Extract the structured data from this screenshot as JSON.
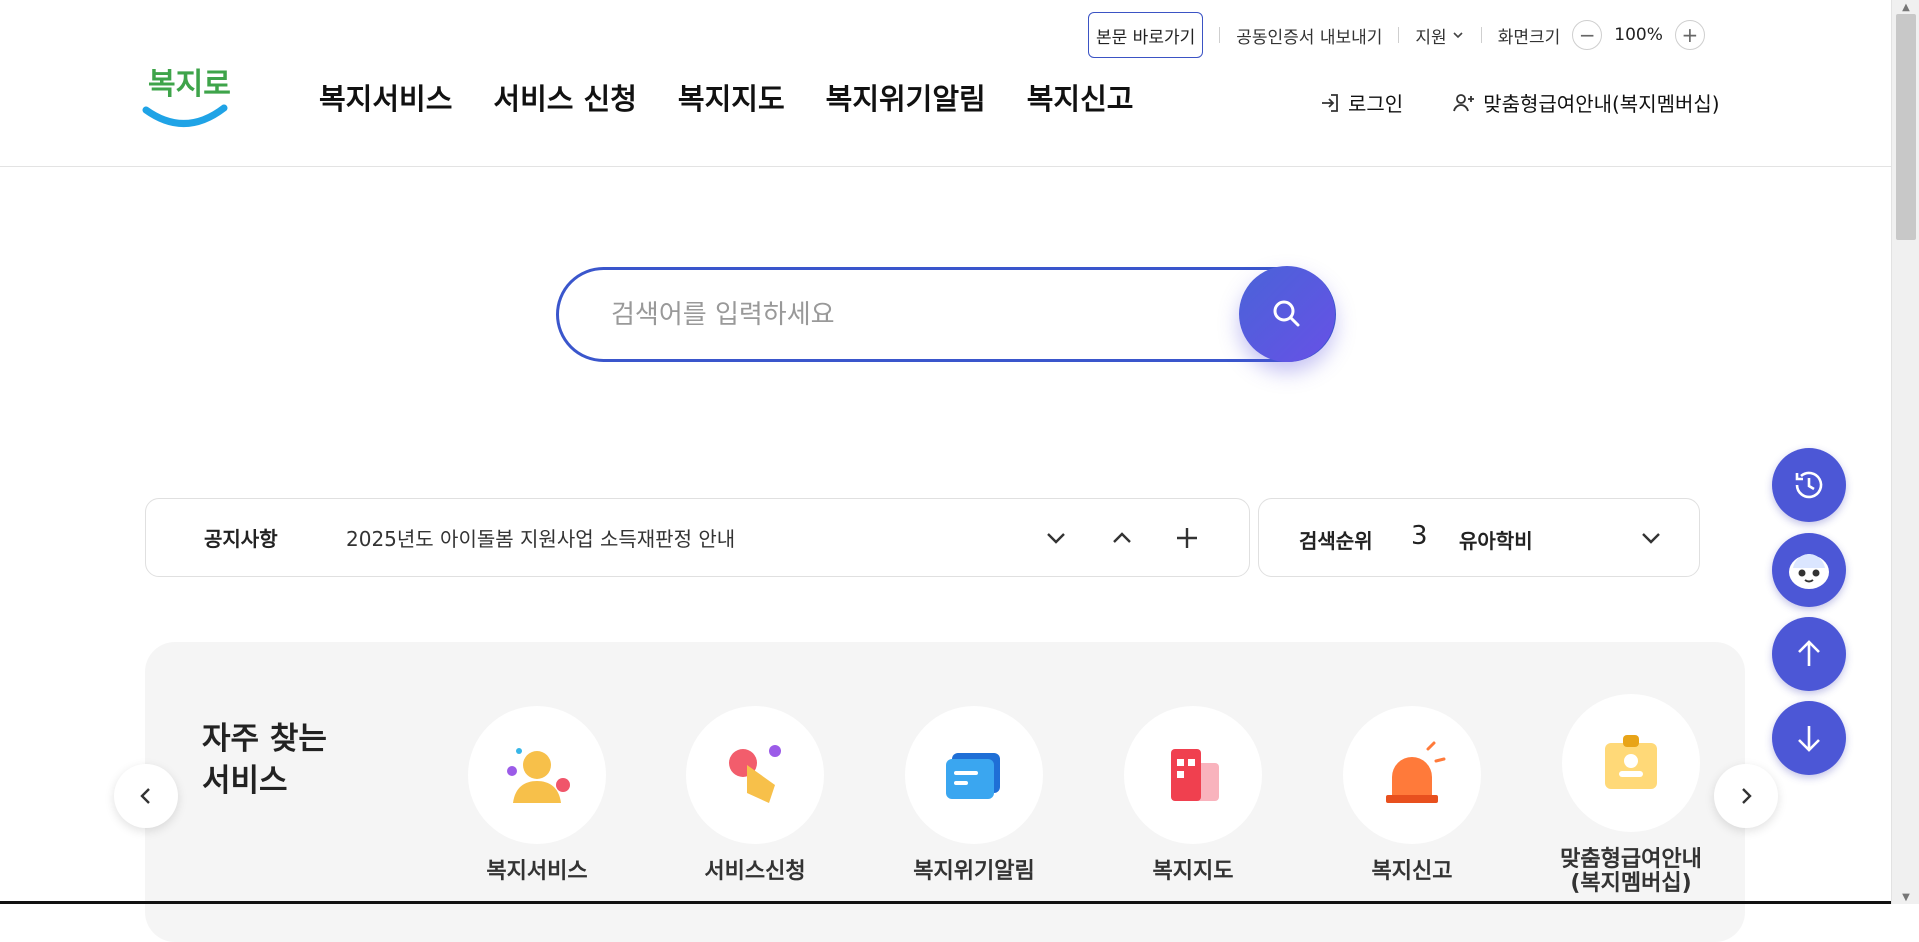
{
  "util": {
    "skip_label": "본문 바로가기",
    "cert_label": "공동인증서 내보내기",
    "support_label": "지원",
    "zoom_label": "화면크기",
    "zoom_minus": "−",
    "zoom_value": "100%",
    "zoom_plus": "+"
  },
  "header": {
    "logo_text": "복지로",
    "nav": [
      "복지서비스",
      "서비스 신청",
      "복지지도",
      "복지위기알림",
      "복지신고"
    ],
    "login_label": "로그인",
    "membership_label": "맞춤형급여안내(복지멤버십)"
  },
  "search": {
    "placeholder": "검색어를 입력하세요"
  },
  "notice": {
    "title": "공지사항",
    "text": "2025년도 아이돌봄 지원사업 소득재판정 안내"
  },
  "rank": {
    "label": "검색순위",
    "number": "3",
    "keyword": "유아학비"
  },
  "frequent": {
    "title": "자주 찾는 서비스",
    "items": [
      {
        "label": "복지서비스"
      },
      {
        "label": "서비스신청"
      },
      {
        "label": "복지위기알림"
      },
      {
        "label": "복지지도"
      },
      {
        "label": "복지신고"
      },
      {
        "label": "맞춤형급여안내\n(복지멤버십)"
      }
    ]
  },
  "colors": {
    "primary": "#3a56cc",
    "accent": "#4c57d6",
    "logo_blue": "#1fa3e6"
  }
}
